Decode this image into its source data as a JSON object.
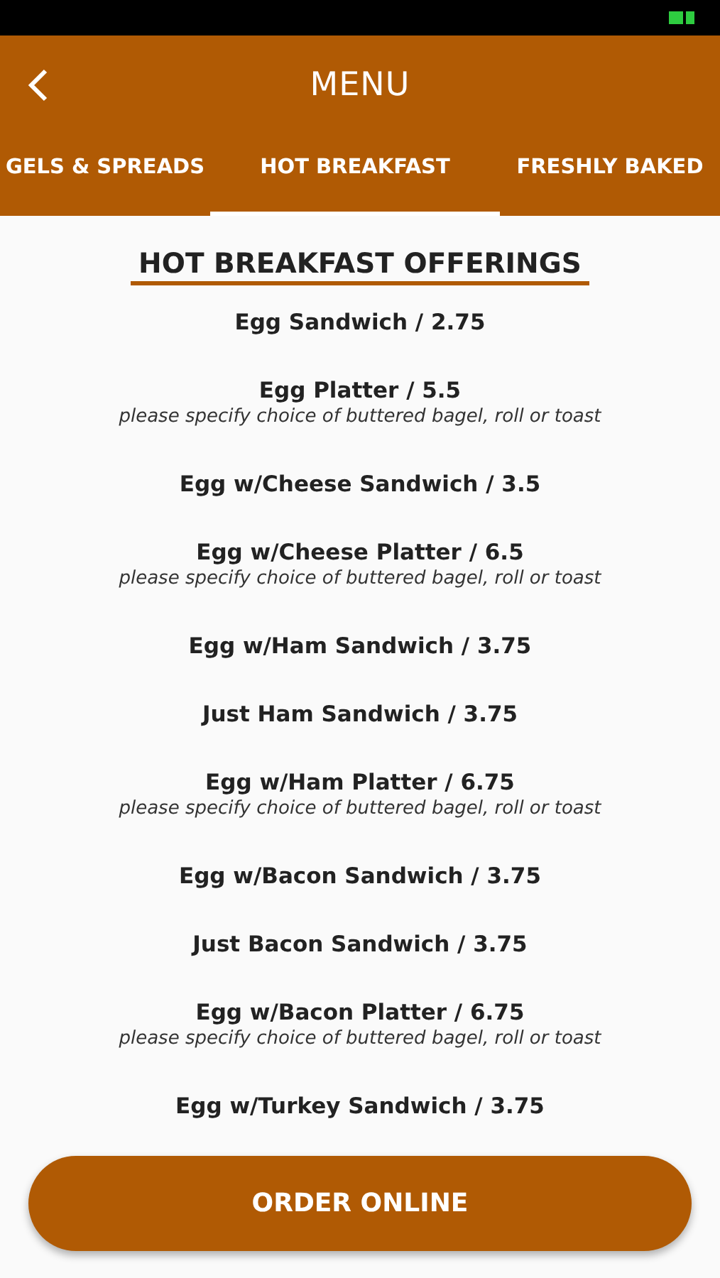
{
  "header": {
    "title": "MENU"
  },
  "tabs": [
    {
      "label": "GELS & SPREADS",
      "selected": false
    },
    {
      "label": "HOT BREAKFAST",
      "selected": true
    },
    {
      "label": "FRESHLY BAKED",
      "selected": false
    }
  ],
  "section": {
    "title": "HOT BREAKFAST OFFERINGS"
  },
  "items": [
    {
      "name": "Egg Sandwich / 2.75"
    },
    {
      "name": "Egg Platter / 5.5",
      "note": "please specify choice of buttered bagel, roll or toast"
    },
    {
      "name": "Egg w/Cheese Sandwich / 3.5"
    },
    {
      "name": "Egg w/Cheese Platter / 6.5",
      "note": "please specify choice of buttered bagel, roll or toast"
    },
    {
      "name": "Egg w/Ham Sandwich / 3.75"
    },
    {
      "name": "Just Ham Sandwich / 3.75"
    },
    {
      "name": "Egg w/Ham Platter / 6.75",
      "note": "please specify choice of buttered bagel, roll or toast"
    },
    {
      "name": "Egg w/Bacon Sandwich / 3.75"
    },
    {
      "name": "Just Bacon Sandwich / 3.75"
    },
    {
      "name": "Egg w/Bacon Platter / 6.75",
      "note": "please specify choice of buttered bagel, roll or toast"
    },
    {
      "name": "Egg w/Turkey Sandwich / 3.75"
    }
  ],
  "order_button": {
    "label": "ORDER ONLINE"
  }
}
